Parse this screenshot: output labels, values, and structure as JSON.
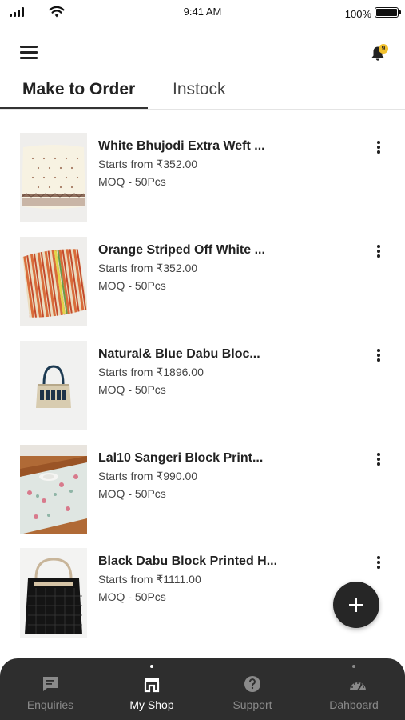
{
  "status_bar": {
    "time": "9:41 AM",
    "battery": "100%"
  },
  "header": {
    "notification_count": "9"
  },
  "tabs": [
    {
      "label": "Make to Order",
      "active": true
    },
    {
      "label": "Instock",
      "active": false
    }
  ],
  "products": [
    {
      "title": "White Bhujodi Extra Weft ...",
      "price": "Starts from ₹352.00",
      "moq": "MOQ - 50Pcs",
      "image": "white-cushion"
    },
    {
      "title": "Orange Striped Off White ...",
      "price": "Starts from ₹352.00",
      "moq": "MOQ - 50Pcs",
      "image": "striped-cushion"
    },
    {
      "title": "Natural& Blue Dabu Bloc...",
      "price": "Starts from ₹1896.00",
      "moq": "MOQ - 50Pcs",
      "image": "dabu-bag"
    },
    {
      "title": "Lal10 Sangeri Block Print...",
      "price": "Starts from ₹990.00",
      "moq": "MOQ - 50Pcs",
      "image": "table-runner"
    },
    {
      "title": "Black Dabu Block Printed H...",
      "price": "Starts from ₹1111.00",
      "moq": "MOQ - 50Pcs",
      "image": "black-bag"
    }
  ],
  "bottom_nav": [
    {
      "label": "Enquiries",
      "icon": "chat-icon",
      "active": false
    },
    {
      "label": "My Shop",
      "icon": "shop-icon",
      "active": true
    },
    {
      "label": "Support",
      "icon": "help-icon",
      "active": false
    },
    {
      "label": "Dahboard",
      "icon": "gauge-icon",
      "active": false
    }
  ],
  "colors": {
    "accent_dark": "#262626",
    "nav_bg": "#2e2e2e",
    "badge": "#f2c12e"
  }
}
